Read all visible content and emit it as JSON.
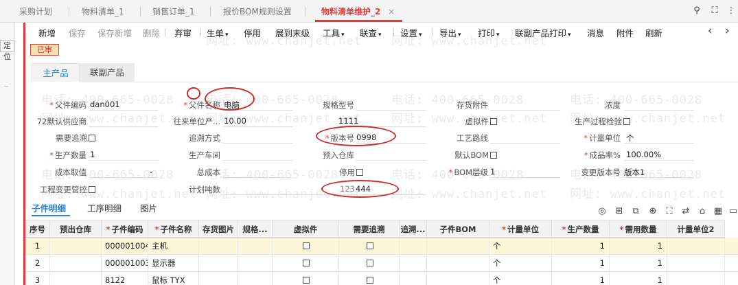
{
  "tabs": [
    {
      "label": "采购计划"
    },
    {
      "label": "物料清单_1"
    },
    {
      "label": "销售订单_1"
    },
    {
      "label": "报价BOM规则设置"
    },
    {
      "label": "物料清单维护_2",
      "close": "×"
    }
  ],
  "window_icons": {
    "search": "⚲",
    "restore": "⛶",
    "more": "⋮"
  },
  "left": {
    "locate_label": "定位"
  },
  "toolbar": {
    "new": "新增",
    "save": "保存",
    "save_new": "保存新增",
    "delete": "删除",
    "abandon": "弃审",
    "generate": "生单",
    "disable": "停用",
    "expand": "展到末级",
    "tools": "工具",
    "query": "联查",
    "settings": "设置",
    "export": "导出",
    "print": "打印",
    "linked_print": "联副产品打印",
    "message": "消息",
    "attachment": "附件",
    "refresh": "刷新",
    "prev": "‹",
    "next": "›"
  },
  "status": "已审",
  "main_tabs": {
    "main": "主产品",
    "linked": "联副产品"
  },
  "form": {
    "parent_code": {
      "label": "父件编码",
      "value": "dan001"
    },
    "parent_name": {
      "label": "父件名称",
      "value": "电脑"
    },
    "spec": {
      "label": "规格型号",
      "value": "1111"
    },
    "inv_attach": {
      "label": "存货附件",
      "value": ""
    },
    "concentration": {
      "label": "浓度",
      "value": ""
    },
    "default_supplier": {
      "label": "72默认供应商",
      "value": ""
    },
    "trade_unit": {
      "label": "往来单位产...",
      "value": "10.00"
    },
    "virtual": {
      "label": "虚拟件"
    },
    "process_check": {
      "label": "生产过程检验"
    },
    "need_trace": {
      "label": "需要追溯"
    },
    "trace_method": {
      "label": "追溯方式",
      "value": ""
    },
    "version": {
      "label": "版本号",
      "value": "0998"
    },
    "route": {
      "label": "工艺路线",
      "value": ""
    },
    "unit": {
      "label": "计量单位",
      "value": "个"
    },
    "prod_qty": {
      "label": "生产数量",
      "value": "1"
    },
    "workshop": {
      "label": "生产车间",
      "value": ""
    },
    "pre_warehouse": {
      "label": "预入仓库",
      "value": ""
    },
    "default_bom": {
      "label": "默认BOM"
    },
    "yield_rate": {
      "label": "成品率%",
      "value": "100.00%"
    },
    "cost_value": {
      "label": "成本取值",
      "value": ""
    },
    "total_cost": {
      "label": "总成本",
      "value": ""
    },
    "stopped": {
      "label": "停用"
    },
    "bom_level": {
      "label": "BOM层级",
      "value": "1"
    },
    "change_version": {
      "label": "变更版本号",
      "value": "版本1"
    },
    "eng_change": {
      "label": "工程变更管控"
    },
    "plan_tonnage": {
      "label": "计划吨数",
      "value": "123",
      "extra": "444"
    }
  },
  "detail_tabs": {
    "components": "子件明细",
    "process": "工序明细",
    "pictures": "图片"
  },
  "tool_icons": [
    "◎",
    "⊞",
    "⧉",
    "⊕",
    "⛶",
    "⇄",
    "⌂",
    "▦",
    "▭"
  ],
  "grid": {
    "headers": [
      "序号",
      "预出仓库",
      "子件编码",
      "子件名称",
      "存货图片",
      "规格...",
      "虚拟件",
      "需要追溯",
      "追溯...",
      "子件BOM",
      "计量单位",
      "生产数量",
      "需用数量",
      "计量单位2"
    ],
    "required_cols": [
      2,
      3,
      10,
      11,
      12
    ],
    "rows": [
      {
        "no": "1",
        "code": "000001004",
        "name": "主机",
        "unit": "个",
        "prod_qty": "1",
        "need_qty": "1"
      },
      {
        "no": "2",
        "code": "000001003",
        "name": "显示器",
        "unit": "个",
        "prod_qty": "1",
        "need_qty": "1"
      },
      {
        "no": "3",
        "code": "8122",
        "name": "鼠标 TYX",
        "unit": "个",
        "prod_qty": "1",
        "need_qty": "1"
      }
    ]
  },
  "watermark": {
    "phone": "电话: 400-665-0028",
    "site": "网址: www.chanjet.net"
  },
  "colors": {
    "accent": "#e23b3b",
    "blue": "#2c7fd0",
    "selected_row": "#fdf6d8"
  }
}
